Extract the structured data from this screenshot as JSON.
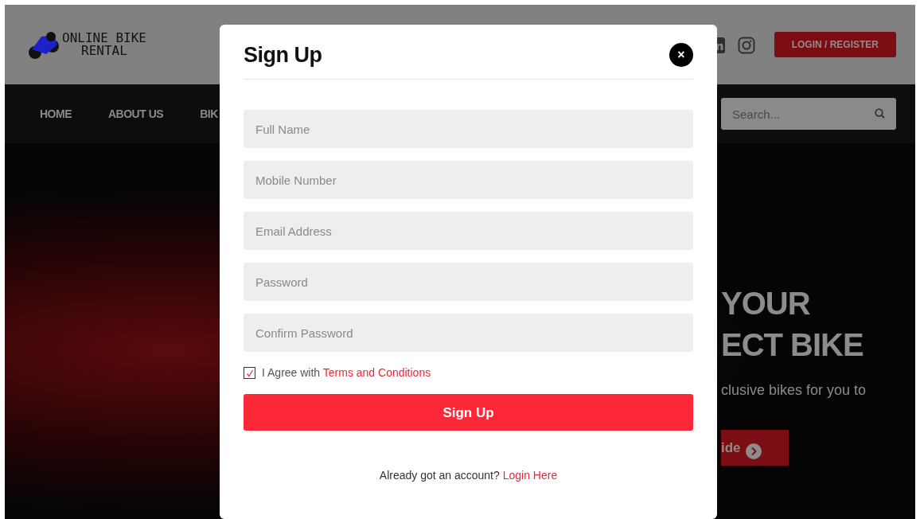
{
  "header": {
    "logo_lines": [
      "ONLINE BIKE",
      "RENTAL"
    ],
    "login_button": "LOGIN / REGISTER"
  },
  "nav": {
    "items": [
      {
        "label": "HOME"
      },
      {
        "label": "ABOUT US"
      },
      {
        "label": "BIK"
      }
    ],
    "search": {
      "placeholder": "Search..."
    }
  },
  "hero": {
    "title_lines": [
      "YOUR",
      "ECT BIKE"
    ],
    "subtitle": "clusive bikes for you to",
    "button": "ide"
  },
  "modal": {
    "title": "Sign Up",
    "close": "×",
    "fields": [
      {
        "placeholder": "Full Name"
      },
      {
        "placeholder": "Mobile Number"
      },
      {
        "placeholder": "Email Address"
      },
      {
        "placeholder": "Password"
      },
      {
        "placeholder": "Confirm Password"
      }
    ],
    "agree": {
      "checked": true,
      "text": "I Agree with",
      "link": "Terms and Conditions"
    },
    "submit": "Sign Up",
    "footer": {
      "text": "Already got an account?",
      "link": "Login Here"
    }
  }
}
